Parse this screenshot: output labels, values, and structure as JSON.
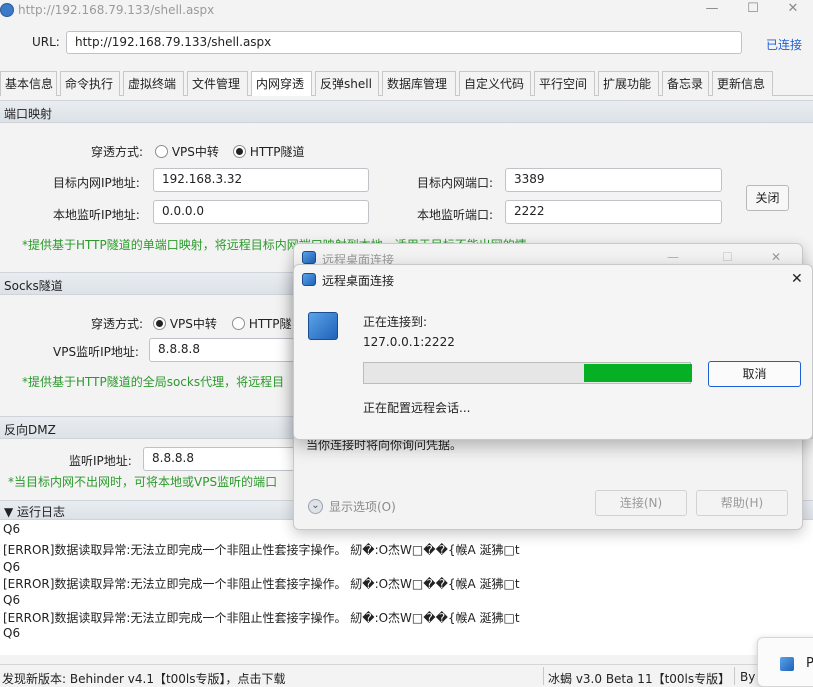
{
  "window": {
    "title": "http://192.168.79.133/shell.aspx",
    "min_glyph": "—",
    "max_glyph": "☐",
    "close_glyph": "✕"
  },
  "url_bar": {
    "label": "URL:",
    "value": "http://192.168.79.133/shell.aspx",
    "status": "已连接"
  },
  "tabs": [
    "基本信息",
    "命令执行",
    "虚拟终端",
    "文件管理",
    "内网穿透",
    "反弹shell",
    "数据库管理",
    "自定义代码",
    "平行空间",
    "扩展功能",
    "备忘录",
    "更新信息"
  ],
  "active_tab": "内网穿透",
  "port_mapping": {
    "header": "端口映射",
    "mode_label": "穿透方式:",
    "mode_options": [
      "VPS中转",
      "HTTP隧道"
    ],
    "mode_selected": "HTTP隧道",
    "target_ip_label": "目标内网IP地址:",
    "target_ip_value": "192.168.3.32",
    "target_port_label": "目标内网端口:",
    "target_port_value": "3389",
    "local_ip_label": "本地监听IP地址:",
    "local_ip_value": "0.0.0.0",
    "local_port_label": "本地监听端口:",
    "local_port_value": "2222",
    "close_button": "关闭",
    "note": "*提供基于HTTP隧道的单端口映射，将远程目标内网端口映射到本地，适用于目标不能出网的情"
  },
  "socks": {
    "header": "Socks隧道",
    "mode_label": "穿透方式:",
    "mode_options": [
      "VPS中转",
      "HTTP隧道"
    ],
    "mode_selected": "VPS中转",
    "vps_ip_label": "VPS监听IP地址:",
    "vps_ip_value": "8.8.8.8",
    "note": "*提供基于HTTP隧道的全局socks代理，将远程目"
  },
  "dmz": {
    "header": "反向DMZ",
    "listen_ip_label": "监听IP地址:",
    "listen_ip_value": "8.8.8.8",
    "note": "*当目标内网不出网时，可将本地或VPS监听的端口"
  },
  "log": {
    "header": "▼ 运行日志",
    "lines": [
      "Q6",
      "[ERROR]数据读取异常:无法立即完成一个非阻止性套接字操作。 紉�:O杰W□��{帿A       涎狒□t",
      "Q6",
      "[ERROR]数据读取异常:无法立即完成一个非阻止性套接字操作。 紉�:O杰W□��{帿A       涎狒□t",
      "Q6",
      "[ERROR]数据读取异常:无法立即完成一个非阻止性套接字操作。 紉�:O杰W□��{帿A       涎狒□t",
      "Q6"
    ]
  },
  "status_bar": {
    "left": "发现新版本: Behinder v4.1【t00ls专版】，点击下载",
    "right": "冰蝎 v3.0 Beta 11【t00ls专版】",
    "by": "By"
  },
  "rdp_back": {
    "title": "远程桌面连接",
    "message": "当你连接时将向你询问凭据。",
    "options": "显示选项(O)",
    "connect": "连接(N)",
    "help": "帮助(H)"
  },
  "rdp_front": {
    "title": "远程桌面连接",
    "connecting_label": "正在连接到:",
    "address": "127.0.0.1:2222",
    "cancel": "取消",
    "status": "正在配置远程会话...",
    "progress": 0.33
  },
  "toast": {
    "text": "P"
  }
}
